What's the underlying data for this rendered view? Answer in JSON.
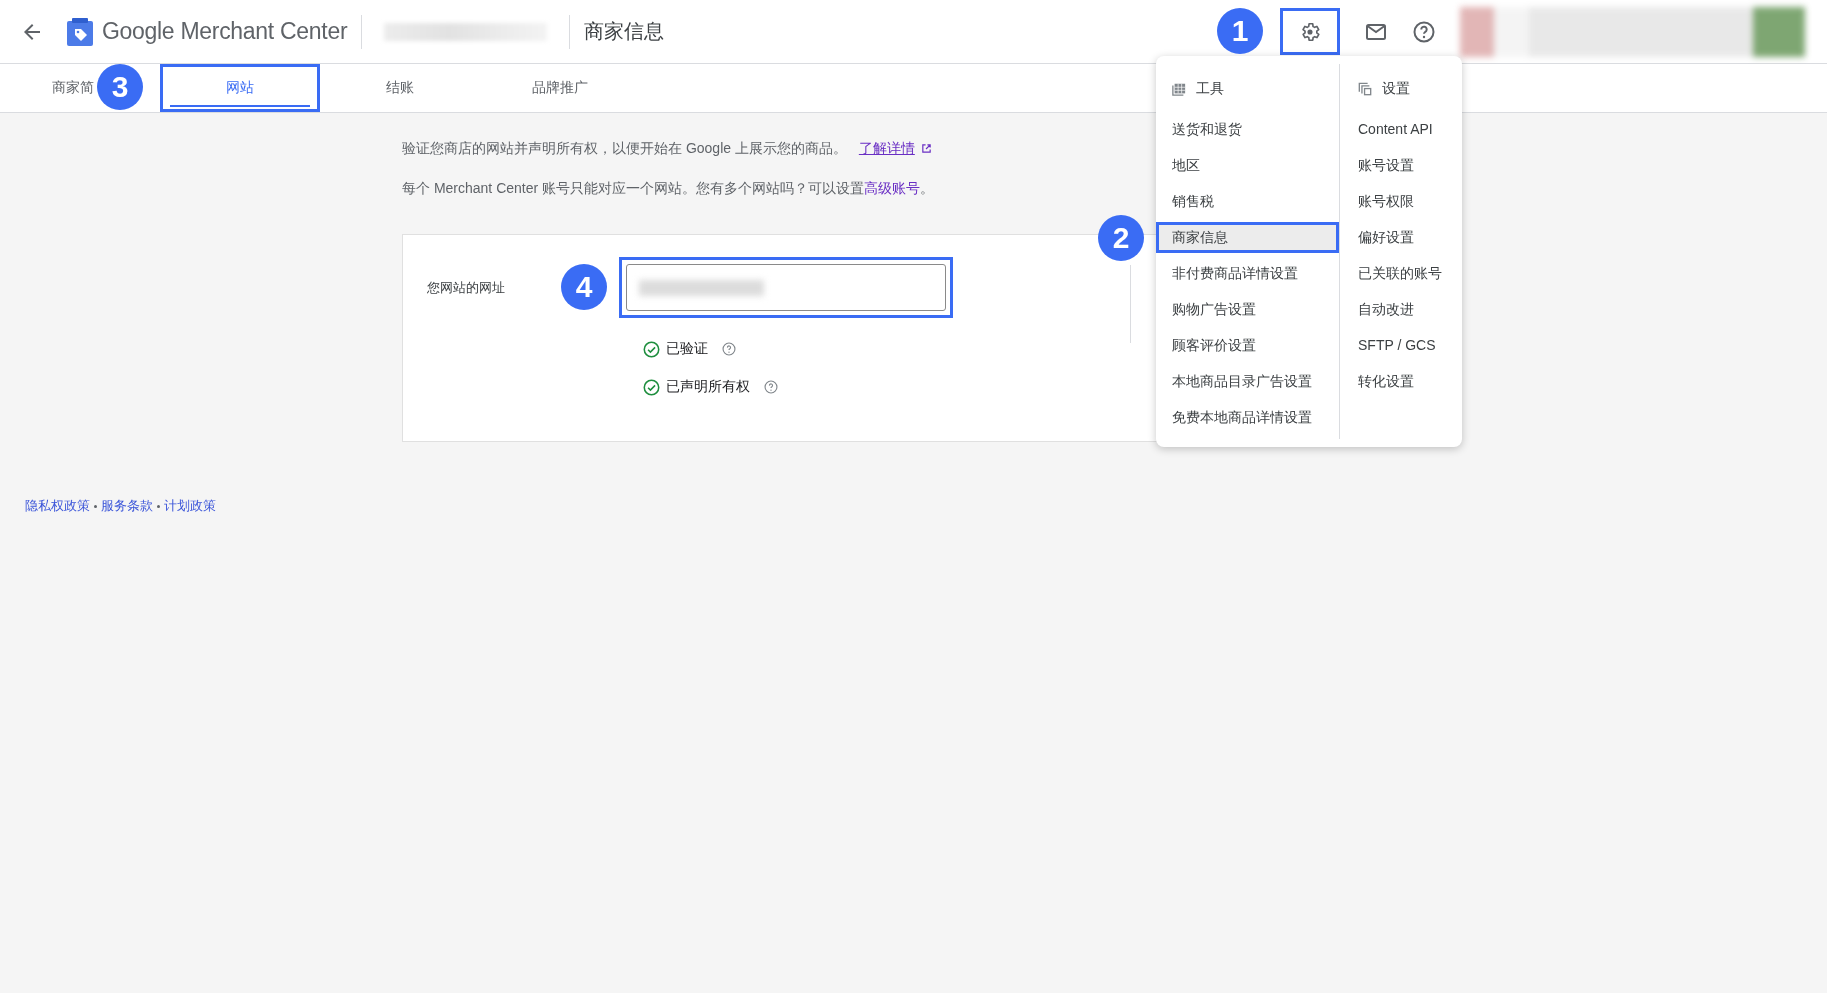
{
  "header": {
    "product": "Google Merchant Center",
    "page_title": "商家信息",
    "settings_button": {
      "highlighted": true,
      "callout": "1"
    }
  },
  "tabs": [
    {
      "label": "商家简",
      "selected": false,
      "highlighted": false
    },
    {
      "label": "网站",
      "selected": true,
      "highlighted": true,
      "callout": "3"
    },
    {
      "label": "结账",
      "selected": false,
      "highlighted": false
    },
    {
      "label": "品牌推广",
      "selected": false,
      "highlighted": false
    }
  ],
  "intro": {
    "text": "验证您商店的网站并声明所有权，以便开始在 Google 上展示您的商品。",
    "link": "了解详情"
  },
  "note": {
    "text": "每个 Merchant Center 账号只能对应一个网站。您有多个网站吗？可以设置",
    "link": "高级账号",
    "end": "。"
  },
  "website_card": {
    "label": "您网站的网址",
    "field": {
      "highlighted": true,
      "callout": "4"
    },
    "statuses": [
      {
        "label": "已验证",
        "checked": true
      },
      {
        "label": "已声明所有权",
        "checked": true
      }
    ]
  },
  "footer_links": [
    "隐私权政策",
    "服务条款",
    "计划政策"
  ],
  "menu": {
    "columns": [
      {
        "kind": "tools",
        "heading": "工具",
        "items": [
          {
            "label": "送货和退货",
            "selected": false,
            "highlighted": false
          },
          {
            "label": "地区",
            "selected": false,
            "highlighted": false
          },
          {
            "label": "销售税",
            "selected": false,
            "highlighted": false
          },
          {
            "label": "商家信息",
            "selected": true,
            "highlighted": true,
            "callout": "2"
          },
          {
            "label": "非付费商品详情设置",
            "selected": false,
            "highlighted": false
          },
          {
            "label": "购物广告设置",
            "selected": false,
            "highlighted": false
          },
          {
            "label": "顾客评价设置",
            "selected": false,
            "highlighted": false
          },
          {
            "label": "本地商品目录广告设置",
            "selected": false,
            "highlighted": false
          },
          {
            "label": "免费本地商品详情设置",
            "selected": false,
            "highlighted": false
          }
        ]
      },
      {
        "kind": "settings",
        "heading": "设置",
        "items": [
          {
            "label": "Content API",
            "selected": false,
            "highlighted": false
          },
          {
            "label": "账号设置",
            "selected": false,
            "highlighted": false
          },
          {
            "label": "账号权限",
            "selected": false,
            "highlighted": false
          },
          {
            "label": "偏好设置",
            "selected": false,
            "highlighted": false
          },
          {
            "label": "已关联的账号",
            "selected": false,
            "highlighted": false
          },
          {
            "label": "自动改进",
            "selected": false,
            "highlighted": false
          },
          {
            "label": "SFTP / GCS",
            "selected": false,
            "highlighted": false
          },
          {
            "label": "转化设置",
            "selected": false,
            "highlighted": false
          }
        ]
      }
    ]
  }
}
